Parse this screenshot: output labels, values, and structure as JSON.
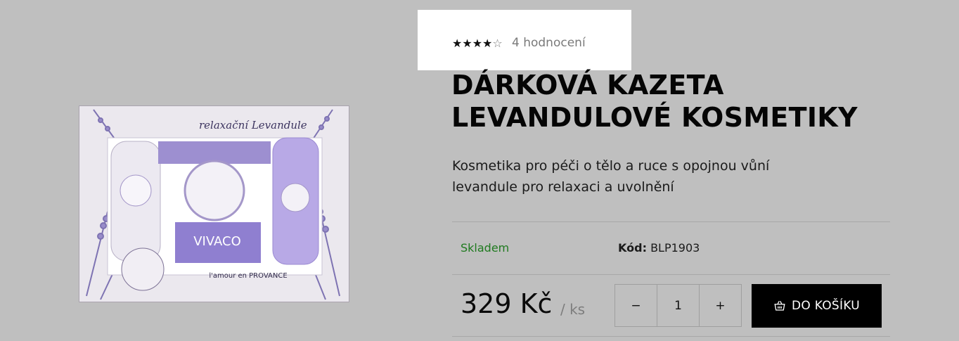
{
  "rating": {
    "stars_filled": 4,
    "stars_total": 5,
    "stars_display": "★★★★",
    "stars_empty_display": "☆",
    "count_text": "4 hodnocení"
  },
  "product": {
    "title_line1": "DÁRKOVÁ KAZETA",
    "title_line2": "LEVANDULOVÉ KOSMETIKY",
    "description_line1": "Kosmetika pro péči o tělo a ruce s opojnou vůní",
    "description_line2": "levandule pro relaxaci a uvolnění",
    "stock": "Skladem",
    "code_label": "Kód:",
    "code_value": "BLP1903",
    "price": "329 Kč",
    "unit": "/ ks",
    "image_alt": "Dárková kazeta levandulové kosmetiky",
    "image_text": {
      "header": "relaxační Levandule",
      "footer": "l'amour en PROVANCE",
      "soap": "VIVACO"
    }
  },
  "quantity": {
    "minus": "−",
    "value": "1",
    "plus": "+"
  },
  "cart_button": {
    "label": "DO KOŠÍKU",
    "icon": "basket-icon"
  },
  "colors": {
    "overlay": "#bfbfbf",
    "stock_green": "#1f7a1f",
    "button_bg": "#000000"
  }
}
